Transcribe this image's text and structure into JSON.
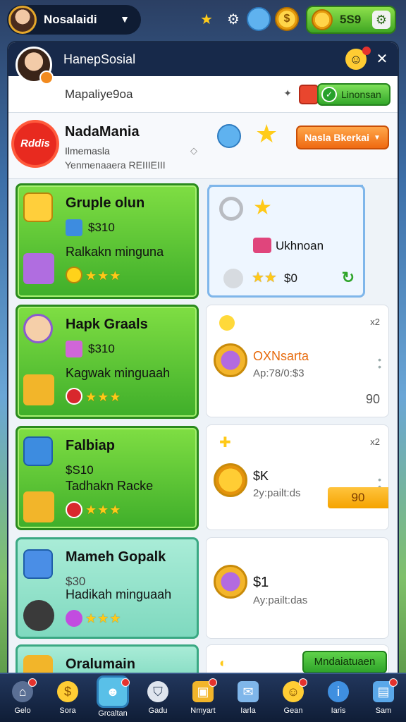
{
  "topbar": {
    "username": "Nosalaidi",
    "coins": "5S9"
  },
  "panel": {
    "title": "HanepSosial",
    "search_label": "Mapaliye9oa",
    "link_button": "Linonsan"
  },
  "featured": {
    "badge": "Rddis",
    "title": "NadaMania",
    "subtitle": "Ilmemasla",
    "subtitle2": "Yenmenaaera REIIIEIII",
    "button": "Nasla Bkerkai"
  },
  "cards_left": [
    {
      "title": "Gruple olun",
      "price": "$310",
      "desc": "Ralkakn minguna",
      "stars": "★★★"
    },
    {
      "title": "Hapk Graals",
      "price": "$310",
      "desc": "Kagwak minguaah",
      "stars": "★★★"
    },
    {
      "title": "Falbiap",
      "price": "$S10",
      "desc": "Tadhakn Racke",
      "stars": "★★★"
    },
    {
      "title": "Mameh Gopalk",
      "price": "$30",
      "desc": "Hadikah minguaah",
      "stars": "★★★"
    },
    {
      "title": "Oralumain"
    }
  ],
  "cards_right": [
    {
      "title": "Ukhnoan",
      "value": "$0"
    },
    {
      "top": "x2",
      "title": "OXNsarta",
      "sub": "Ap:78/0:$3",
      "num": "90"
    },
    {
      "top": "x2",
      "title": "$K",
      "sub": "2y:pailt:ds",
      "num": "90"
    },
    {
      "title": "$1",
      "sub": "Ay:pailt:das"
    },
    {
      "button": "Mndaiatuaen"
    }
  ],
  "nav": [
    {
      "label": "Gelo",
      "icon": "home-icon"
    },
    {
      "label": "Sora",
      "icon": "coin-icon"
    },
    {
      "label": "Grcaltan",
      "icon": "social-icon"
    },
    {
      "label": "Gadu",
      "icon": "shield-icon"
    },
    {
      "label": "Nmyart",
      "icon": "shop-icon"
    },
    {
      "label": "Iarla",
      "icon": "mail-icon"
    },
    {
      "label": "Gean",
      "icon": "smiley-icon"
    },
    {
      "label": "Iaris",
      "icon": "info-icon"
    },
    {
      "label": "Sam",
      "icon": "notes-icon"
    }
  ],
  "colors": {
    "accent_green": "#3fae2a",
    "accent_orange": "#ef6a12",
    "navy": "#17294a"
  }
}
